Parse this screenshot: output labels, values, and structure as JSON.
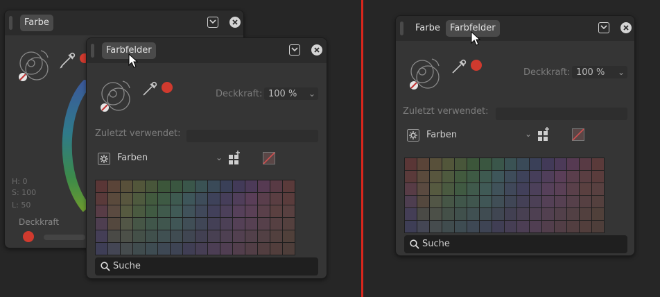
{
  "left": {
    "back_panel": {
      "tab": "Farbe",
      "hsl": [
        "H: 0",
        "S: 100",
        "L: 50"
      ],
      "opacity_label": "Deckkraft"
    },
    "front_panel": {
      "tab": "Farbfelder",
      "opacity_label": "Deckkraft:",
      "opacity_value": "100 %",
      "recent_label": "Zuletzt verwendet:",
      "palette_name": "Farben",
      "search_placeholder": "Suche"
    }
  },
  "right": {
    "panel": {
      "tabs": [
        "Farbe",
        "Farbfelder"
      ],
      "opacity_label": "Deckkraft:",
      "opacity_value": "100 %",
      "recent_label": "Zuletzt verwendet:",
      "palette_name": "Farben",
      "search_placeholder": "Suche"
    }
  },
  "colors": {
    "accent_red": "#d03a2e",
    "divider_red": "#d9261c"
  },
  "swatches": [
    [
      "#5a3636",
      "#5a4438",
      "#58503a",
      "#52563a",
      "#48563a",
      "#3c563a",
      "#3a5640",
      "#3a564a",
      "#3a5254",
      "#3a4a58",
      "#3a4058",
      "#423a58",
      "#4c3a58",
      "#563a52",
      "#583a44",
      "#5a3a3a"
    ],
    [
      "#5a3a3a",
      "#5a4a3c",
      "#58563e",
      "#4e5a3e",
      "#425a3e",
      "#3e5a44",
      "#3e5a50",
      "#3e565a",
      "#3e4c5a",
      "#3e425a",
      "#463e5a",
      "#503e5a",
      "#5a3e58",
      "#5a3e4c",
      "#5a3e42",
      "#5a3c3c"
    ],
    [
      "#583c46",
      "#5a4a40",
      "#565a40",
      "#4a5a40",
      "#405a42",
      "#405a4c",
      "#405a56",
      "#40525a",
      "#40485a",
      "#42405a",
      "#4c405a",
      "#56405a",
      "#5a4056",
      "#5a404a",
      "#5a4040",
      "#584040"
    ],
    [
      "#4e3e50",
      "#54483e",
      "#525646",
      "#465646",
      "#40564a",
      "#40564e",
      "#405656",
      "#404e56",
      "#404656",
      "#444056",
      "#4c4056",
      "#544056",
      "#564052",
      "#56404a",
      "#564042",
      "#54403e"
    ],
    [
      "#443e56",
      "#4a4a46",
      "#4c5048",
      "#445048",
      "#40504c",
      "#405052",
      "#404c52",
      "#404652",
      "#424052",
      "#484052",
      "#4e4052",
      "#524050",
      "#52404a",
      "#524044",
      "#52403e",
      "#50403a"
    ],
    [
      "#3e3e56",
      "#444654",
      "#464c4e",
      "#404c4e",
      "#3e4c52",
      "#3e4854",
      "#3e4454",
      "#403e54",
      "#463e54",
      "#4c3e54",
      "#503e52",
      "#523e4c",
      "#523e46",
      "#523e40",
      "#523e3c",
      "#4e3e3a"
    ]
  ]
}
